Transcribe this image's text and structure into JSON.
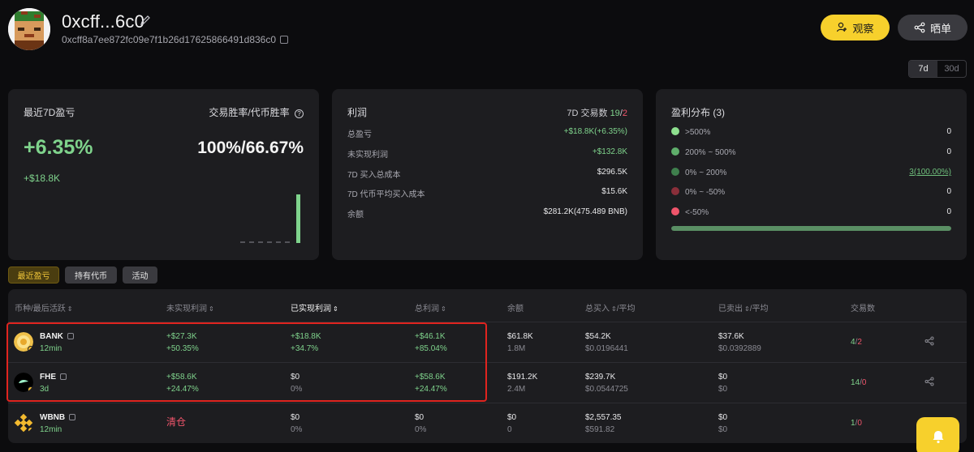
{
  "header": {
    "name": "0xcff...6c0",
    "address": "0xcff8a7ee872fc09e7f1b26d17625866491d836c0",
    "watch_label": "观察",
    "share_label": "晒单",
    "range_options": [
      "7d",
      "30d"
    ],
    "range_selected": "7d"
  },
  "pnl_card": {
    "title": "最近7D盈亏",
    "winrate_label": "交易胜率/代币胜率",
    "percent": "+6.35%",
    "amount": "+$18.8K",
    "winrate": "100%/66.67%"
  },
  "profit_card": {
    "title": "利润",
    "trades_label": "7D 交易数",
    "trades_win": "19",
    "trades_sep": "/",
    "trades_loss": "2",
    "rows": [
      {
        "label": "总盈亏",
        "value": "+$18.8K(+6.35%)"
      },
      {
        "label": "未实现利润",
        "value": "+$132.8K"
      },
      {
        "label": "7D 买入总成本",
        "value": "$296.5K"
      },
      {
        "label": "7D 代币平均买入成本",
        "value": "$15.6K"
      },
      {
        "label": "余额",
        "value": "$281.2K(475.489 BNB)"
      }
    ]
  },
  "dist_card": {
    "title": "盈利分布 (3)",
    "rows": [
      {
        "label": ">500%",
        "value": "0",
        "color": "#8ee08f"
      },
      {
        "label": "200% ~ 500%",
        "value": "0",
        "color": "#5fae6b"
      },
      {
        "label": "0% ~ 200%",
        "value": "3(100.00%)",
        "color": "#3f7f4d"
      },
      {
        "label": "0% ~ -50%",
        "value": "0",
        "color": "#8a2f3a"
      },
      {
        "label": "<-50%",
        "value": "0",
        "color": "#f0556b"
      }
    ],
    "bar_fraction": 1.0
  },
  "tabs": [
    "最近盈亏",
    "持有代币",
    "活动"
  ],
  "table": {
    "headers": [
      "币种/最后活跃",
      "未实现利润",
      "已实现利润",
      "总利润",
      "余额",
      "总买入",
      "/平均",
      "已卖出",
      "/平均",
      "交易数"
    ],
    "rows": [
      {
        "symbol": "BANK",
        "active": "12min",
        "unreal": "+$27.3K",
        "unreal_pct": "+50.35%",
        "real": "+$18.8K",
        "real_pct": "+34.7%",
        "total": "+$46.1K",
        "total_pct": "+85.04%",
        "bal": "$61.8K",
        "bal_qty": "1.8M",
        "buy": "$54.2K",
        "buy_avg": "$0.0196441",
        "sell": "$37.6K",
        "sell_avg": "$0.0392889",
        "tx_win": "4",
        "tx_sep": "/",
        "tx_loss": "2"
      },
      {
        "symbol": "FHE",
        "active": "3d",
        "unreal": "+$58.6K",
        "unreal_pct": "+24.47%",
        "real": "$0",
        "real_pct": "0%",
        "total": "+$58.6K",
        "total_pct": "+24.47%",
        "bal": "$191.2K",
        "bal_qty": "2.4M",
        "buy": "$239.7K",
        "buy_avg": "$0.0544725",
        "sell": "$0",
        "sell_avg": "$0",
        "tx_win": "14",
        "tx_sep": "/",
        "tx_loss": "0"
      },
      {
        "symbol": "WBNB",
        "active": "12min",
        "unreal_status": "清仓",
        "real": "$0",
        "real_pct": "0%",
        "total": "$0",
        "total_pct": "0%",
        "bal": "$0",
        "bal_qty": "0",
        "buy": "$2,557.35",
        "buy_avg": "$591.82",
        "sell": "$0",
        "sell_avg": "$0",
        "tx_win": "1",
        "tx_sep": "/",
        "tx_loss": "0"
      }
    ]
  },
  "colors": {
    "accent": "#f7d02c",
    "profit": "#7fd38c",
    "loss": "#f0556b",
    "highlight": "#e0241f"
  }
}
